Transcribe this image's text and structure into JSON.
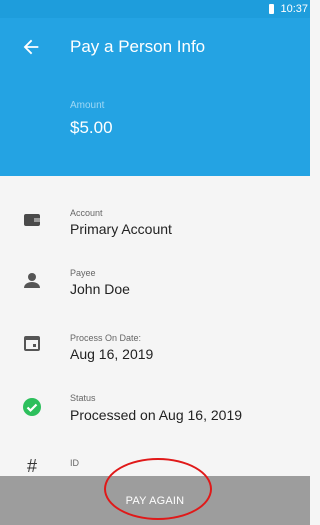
{
  "status_bar": {
    "time": "10:37",
    "battery_icon": "battery-icon"
  },
  "header": {
    "back_icon": "arrow-left-icon",
    "title": "Pay a Person Info",
    "amount_label": "Amount",
    "amount_value": "$5.00"
  },
  "details": [
    {
      "icon": "wallet-icon",
      "label": "Account",
      "value": "Primary Account"
    },
    {
      "icon": "person-icon",
      "label": "Payee",
      "value": "John Doe"
    },
    {
      "icon": "calendar-icon",
      "label": "Process On Date:",
      "value": "Aug 16, 2019"
    },
    {
      "icon": "check-circle-icon",
      "label": "Status",
      "value": "Processed on Aug 16, 2019"
    },
    {
      "icon": "hash-icon",
      "label": "ID",
      "value": ""
    }
  ],
  "footer": {
    "pay_again_label": "PAY AGAIN"
  },
  "colors": {
    "header": "#24a3e3",
    "status_bar": "#1e9ddc",
    "success": "#2dbf5c",
    "annotation": "#e01919"
  }
}
